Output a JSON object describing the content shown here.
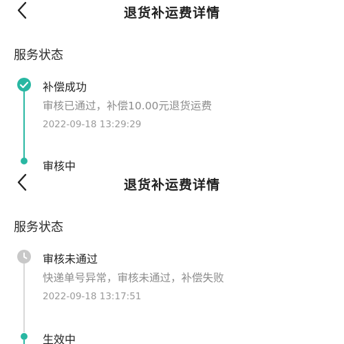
{
  "panels": [
    {
      "title": "退货补运费详情",
      "section_title": "服务状态",
      "events": [
        {
          "status": "补偿成功",
          "detail": "审核已通过，补偿10.00元退货运费",
          "time": "2022-09-18 13:29:29",
          "icon": "check-circle-icon",
          "icon_color": "#28b7a2"
        },
        {
          "status": "审核中",
          "icon": "dot",
          "icon_color": "#28b7a2"
        }
      ]
    },
    {
      "title": "退货补运费详情",
      "section_title": "服务状态",
      "events": [
        {
          "status": "审核未通过",
          "detail": "快递单号异常，审核未通过，补偿失败",
          "time": "2022-09-18 13:17:51",
          "icon": "clock-icon",
          "icon_color": "#c8c8c8"
        },
        {
          "status": "生效中",
          "icon": "dot",
          "icon_color": "#28b7a2"
        }
      ]
    }
  ],
  "colors": {
    "accent": "#28b7a2",
    "muted_text": "#8c8c8c",
    "pending_icon": "#c8c8c8"
  }
}
